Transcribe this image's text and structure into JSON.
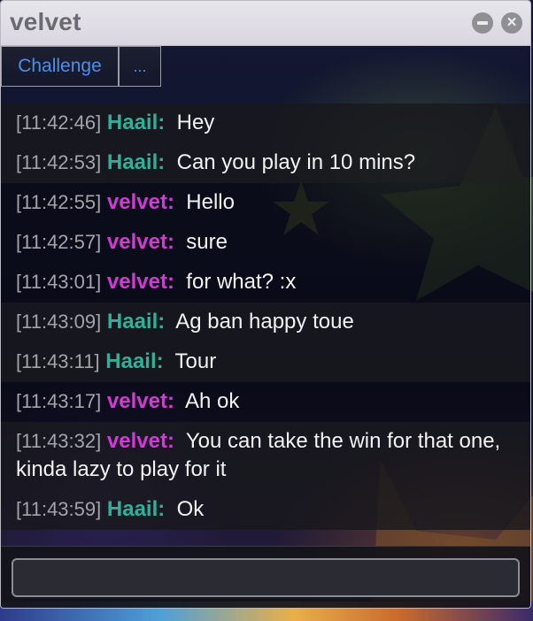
{
  "window": {
    "title": "velvet",
    "controls": [
      "minimize-icon",
      "close-icon"
    ],
    "close_glyph": "×"
  },
  "toolbar": {
    "challenge_label": "Challenge",
    "more_label": "..."
  },
  "colors": {
    "user_haail": "#2bb39a",
    "user_velvet": "#d13bd3",
    "link": "#4c8fe8"
  },
  "messages": [
    {
      "time": "[11:42:46]",
      "user": "Haail:",
      "text": "Hey"
    },
    {
      "time": "[11:42:53]",
      "user": "Haail:",
      "text": "Can you play in 10 mins?"
    },
    {
      "time": "[11:42:55]",
      "user": "velvet:",
      "text": "Hello"
    },
    {
      "time": "[11:42:57]",
      "user": "velvet:",
      "text": "sure"
    },
    {
      "time": "[11:43:01]",
      "user": "velvet:",
      "text": "for what? :x"
    },
    {
      "time": "[11:43:09]",
      "user": "Haail:",
      "text": "Ag ban happy toue"
    },
    {
      "time": "[11:43:11]",
      "user": "Haail:",
      "text": "Tour"
    },
    {
      "time": "[11:43:17]",
      "user": "velvet:",
      "text": "Ah ok"
    },
    {
      "time": "[11:43:32]",
      "user": "velvet:",
      "text": "You can take the win for that one, kinda lazy to play for it"
    },
    {
      "time": "[11:43:59]",
      "user": "Haail:",
      "text": "Ok"
    }
  ],
  "input": {
    "value": "",
    "placeholder": ""
  }
}
